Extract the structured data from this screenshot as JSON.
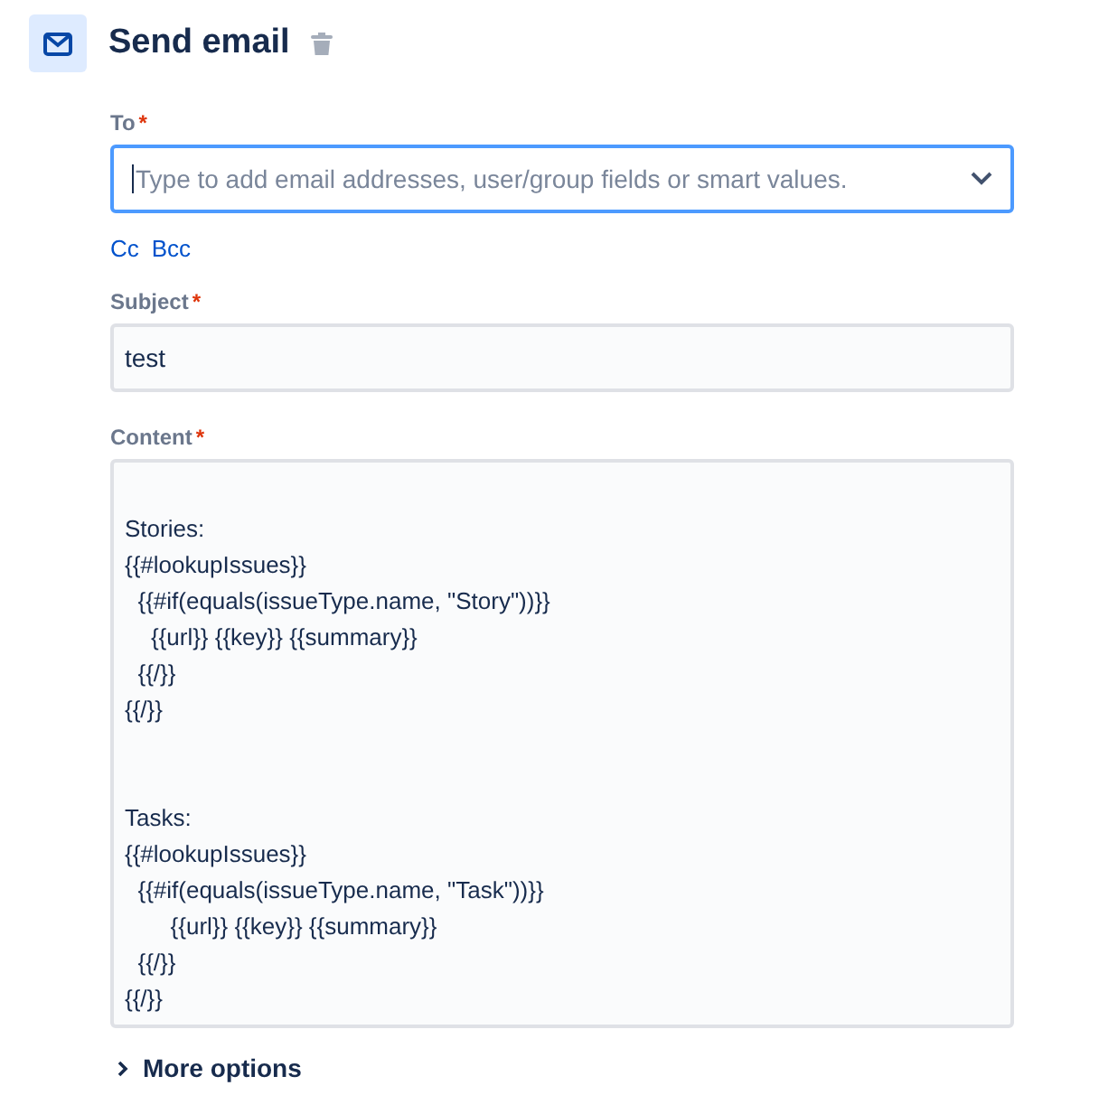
{
  "header": {
    "title": "Send email"
  },
  "to": {
    "label": "To",
    "required_mark": "*",
    "placeholder": "Type to add email addresses, user/group fields or smart values.",
    "focused": true
  },
  "links": [
    "Cc",
    "Bcc"
  ],
  "subject": {
    "label": "Subject",
    "required_mark": "*",
    "value": "test"
  },
  "content": {
    "label": "Content",
    "required_mark": "*",
    "value": "\nStories:\n{{#lookupIssues}}\n  {{#if(equals(issueType.name, \"Story\"))}}\n    {{url}} {{key}} {{summary}}\n  {{/}}\n{{/}}\n\n\nTasks:\n{{#lookupIssues}}\n  {{#if(equals(issueType.name, \"Task\"))}}\n       {{url}} {{key}} {{summary}}\n  {{/}}\n{{/}}"
  },
  "more_options": {
    "label": "More options",
    "expanded": false
  }
}
